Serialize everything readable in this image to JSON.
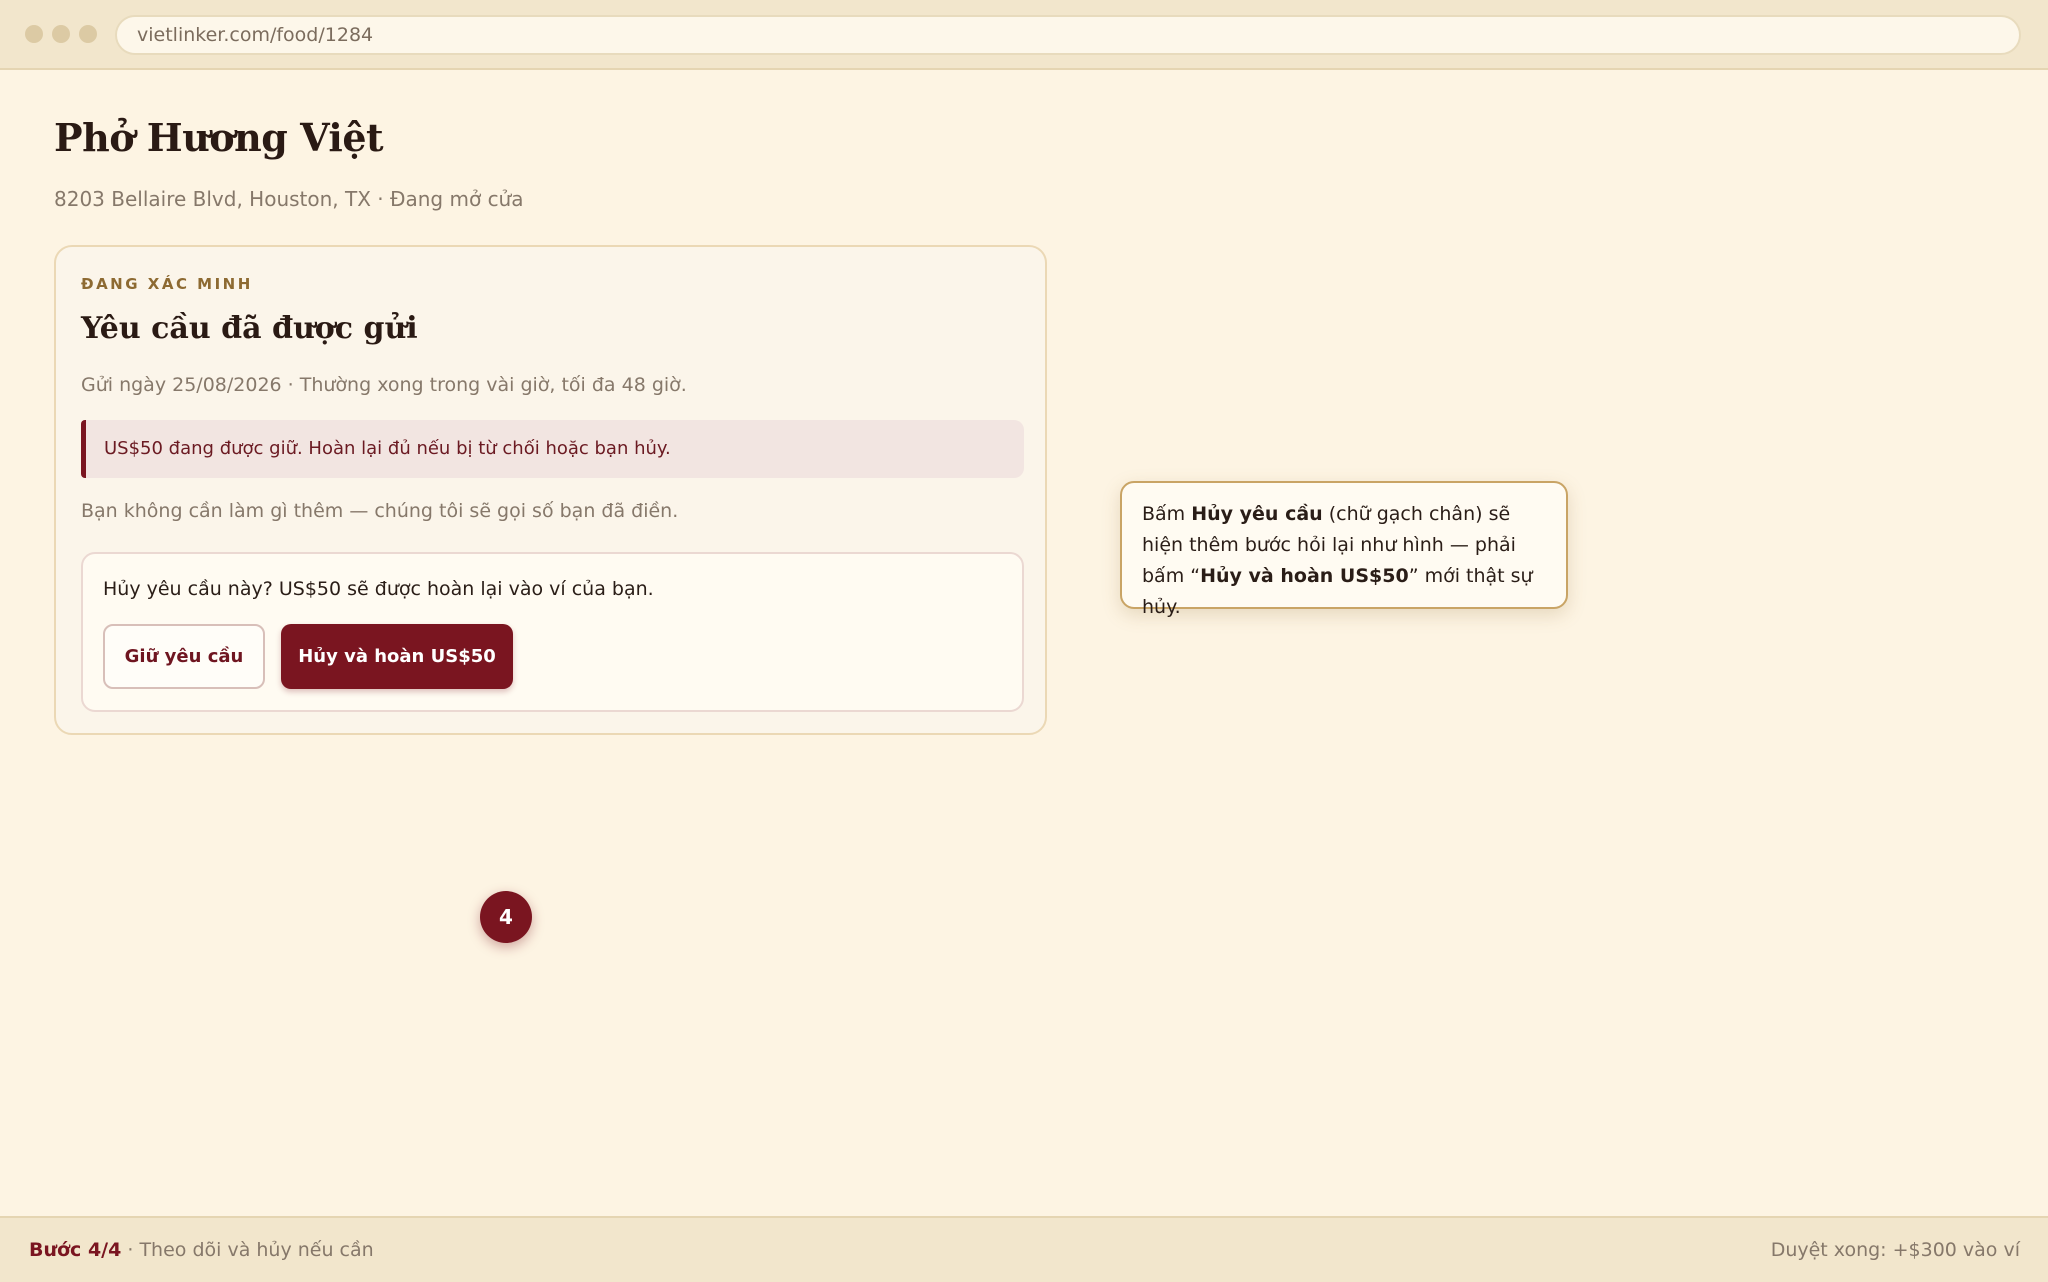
{
  "browser": {
    "url": "vietlinker.com/food/1284"
  },
  "header": {
    "title": "Phở Hương Việt",
    "subtitle": "8203 Bellaire Blvd, Houston, TX · Đang mở cửa"
  },
  "card": {
    "eyebrow": "ĐANG XÁC MINH",
    "title": "Yêu cầu đã được gửi",
    "meta": "Gửi ngày 25/08/2026 · Thường xong trong vài giờ, tối đa 48 giờ.",
    "hold_note": "US$50 đang được giữ. Hoàn lại đủ nếu bị từ chối hoặc bạn hủy.",
    "hint": "Bạn không cần làm gì thêm — chúng tôi sẽ gọi số bạn đã điền.",
    "confirm": {
      "question": "Hủy yêu cầu này? US$50 sẽ được hoàn lại vào ví của bạn.",
      "keep_label": "Giữ yêu cầu",
      "cancel_label": "Hủy và hoàn US$50"
    }
  },
  "step_badge": "4",
  "callout": {
    "p1": "Bấm ",
    "b1": "Hủy yêu cầu",
    "p2": " (chữ gạch chân) sẽ hiện thêm bước hỏi lại như hình — phải bấm “",
    "b2": "Hủy và hoàn US$50",
    "p3": "” mới thật sự hủy."
  },
  "footer": {
    "step": "Bước 4/4",
    "step_desc": " · Theo dõi và hủy nếu cần",
    "right": "Duyệt xong: +$300 vào ví"
  },
  "colors": {
    "background": "#fdf4e3",
    "accent": "#7a1520",
    "eyebrow": "#8d6a32",
    "callout_border": "#c9a465"
  }
}
